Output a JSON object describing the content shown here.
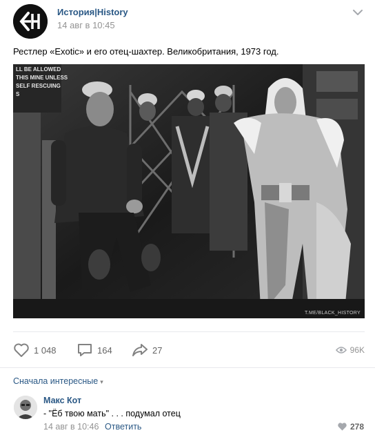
{
  "post": {
    "author": "История|History",
    "date": "14 авг в 10:45",
    "logo_letters": "EH",
    "text": "Рестлер «Exotic» и его отец-шахтер. Великобритания, 1973 год.",
    "photo": {
      "description_icon": "black-and-white-photo",
      "sign_text": "LL BE ALLOWED\nTHIS MINE UNLESS\nSELF RESCUING\nS",
      "watermark": "T.ME/BLACK_HISTORY"
    }
  },
  "actions": {
    "likes": "1 048",
    "comments": "164",
    "shares": "27",
    "views": "96K"
  },
  "icons": {
    "like": "heart-icon",
    "comment": "comment-icon",
    "share": "share-icon",
    "views": "eye-icon",
    "more": "chevron-down-icon"
  },
  "comments": {
    "sort_label": "Сначала интересные",
    "items": [
      {
        "author": "Макс Кот",
        "text": "- \"Ёб твою мать\" . . . подумал отец",
        "date": "14 авг в 10:46",
        "reply_label": "Ответить",
        "likes": "278"
      }
    ]
  },
  "colors": {
    "link": "#2a5885",
    "muted": "#939393",
    "divider": "#e7e8ec",
    "icon": "#828282"
  }
}
